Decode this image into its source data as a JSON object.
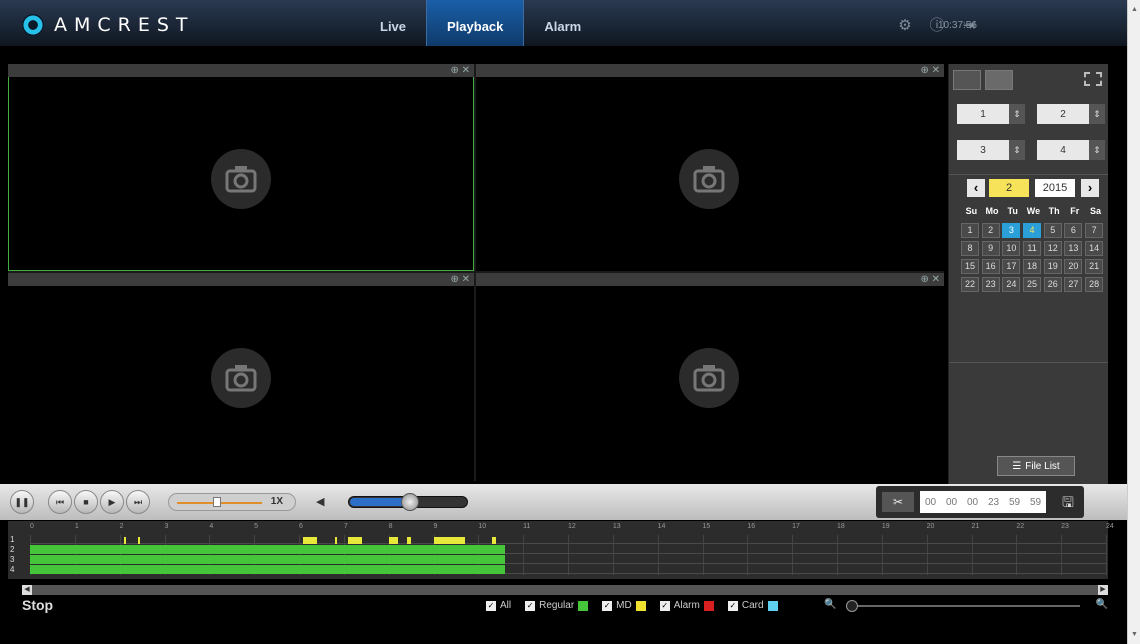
{
  "brand": {
    "logo_text": "AMCREST"
  },
  "nav": {
    "items": [
      "Live",
      "Playback",
      "Alarm"
    ],
    "active": "Playback"
  },
  "header": {
    "clock": "10:37:56"
  },
  "panes": [
    {
      "id": "1",
      "controls": "⊕ ✕"
    },
    {
      "id": "2",
      "controls": "⊕ ✕"
    },
    {
      "id": "3",
      "controls": "⊕ ✕"
    },
    {
      "id": "4",
      "controls": "⊕ ✕"
    }
  ],
  "side": {
    "channels": [
      "1",
      "2",
      "3",
      "4"
    ],
    "calendar": {
      "month": "2",
      "year": "2015",
      "dows": [
        "Su",
        "Mo",
        "Tu",
        "We",
        "Th",
        "Fr",
        "Sa"
      ],
      "days": [
        "1",
        "2",
        "3",
        "4",
        "5",
        "6",
        "7",
        "8",
        "9",
        "10",
        "11",
        "12",
        "13",
        "14",
        "15",
        "16",
        "17",
        "18",
        "19",
        "20",
        "21",
        "22",
        "23",
        "24",
        "25",
        "26",
        "27",
        "28"
      ],
      "recorded_days": [
        "3"
      ],
      "selected_day": "4"
    },
    "file_list_label": "File List"
  },
  "controls": {
    "speed_label": "1X",
    "clip_times": [
      "00",
      "00",
      "00",
      "23",
      "59",
      "59"
    ]
  },
  "timeline": {
    "hours": [
      "0",
      "1",
      "2",
      "3",
      "4",
      "5",
      "6",
      "7",
      "8",
      "9",
      "10",
      "11",
      "12",
      "13",
      "14",
      "15",
      "16",
      "17",
      "18",
      "19",
      "20",
      "21",
      "22",
      "23",
      "24"
    ],
    "channels": [
      "1",
      "2",
      "3",
      "4"
    ]
  },
  "status": {
    "text": "Stop"
  },
  "legend": [
    {
      "label": "All",
      "color": ""
    },
    {
      "label": "Regular",
      "color": "#46c43a"
    },
    {
      "label": "MD",
      "color": "#f0e030"
    },
    {
      "label": "Alarm",
      "color": "#d82020"
    },
    {
      "label": "Card",
      "color": "#5fd0f0"
    }
  ]
}
